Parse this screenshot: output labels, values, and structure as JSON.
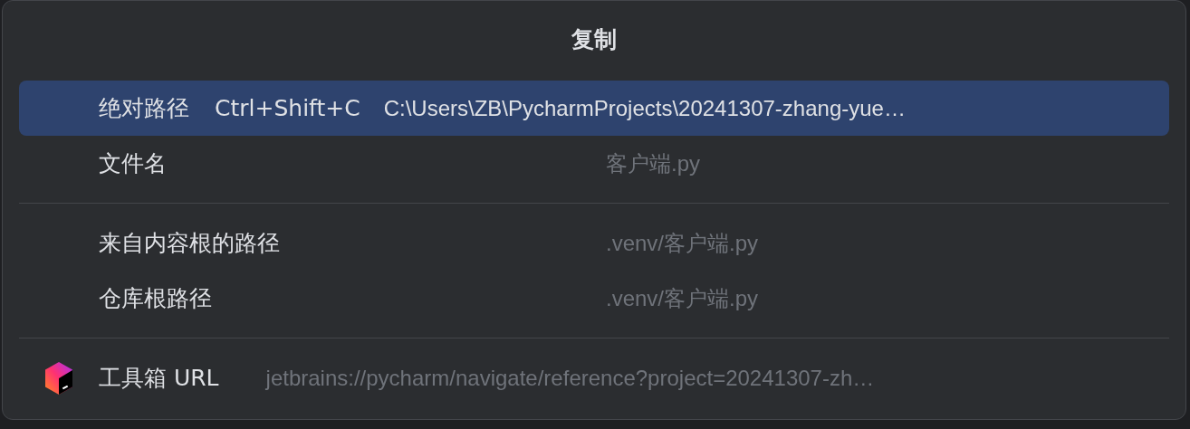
{
  "popup": {
    "title": "复制",
    "sections": [
      {
        "items": [
          {
            "label": "绝对路径",
            "shortcut": "Ctrl+Shift+C",
            "value": "C:\\Users\\ZB\\PycharmProjects\\20241307-zhang-yue…",
            "selected": true
          },
          {
            "label": "文件名",
            "value": "客户端.py",
            "selected": false
          }
        ]
      },
      {
        "items": [
          {
            "label": "来自内容根的路径",
            "value": ".venv/客户端.py",
            "selected": false
          },
          {
            "label": "仓库根路径",
            "value": ".venv/客户端.py",
            "selected": false
          }
        ]
      },
      {
        "items": [
          {
            "label": "工具箱 URL",
            "value": "jetbrains://pycharm/navigate/reference?project=20241307-zh…",
            "selected": false,
            "kind": "toolbox"
          }
        ]
      }
    ]
  }
}
